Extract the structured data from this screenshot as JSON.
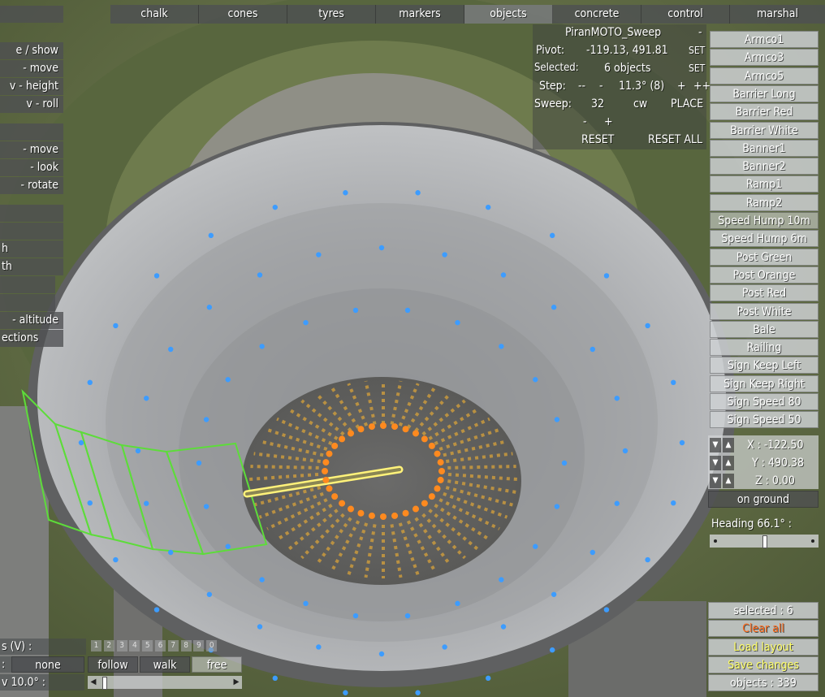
{
  "tabs": [
    "chalk",
    "cones",
    "tyres",
    "markers",
    "objects",
    "concrete",
    "control",
    "marshal"
  ],
  "active_tab": "objects",
  "top_panel": {
    "layout_name": "PiranMOTO_Sweep",
    "collapse": "-",
    "pivot_label": "Pivot:",
    "pivot_value": "-119.13, 491.81",
    "pivot_set": "SET",
    "selected_label": "Selected:",
    "selected_value": "6 objects",
    "selected_set": "SET",
    "step_label": "Step:",
    "step_dec2": "--",
    "step_dec1": "-",
    "step_value": "11.3° (8)",
    "step_inc1": "+",
    "step_inc2": "++",
    "sweep_label": "Sweep:",
    "sweep_value": "32",
    "sweep_dir": "cw",
    "place": "PLACE",
    "sweep_minus": "-",
    "sweep_plus": "+",
    "reset": "RESET",
    "reset_all": "RESET ALL"
  },
  "objects": [
    "Armco1",
    "Armco3",
    "Armco5",
    "Barrier Long",
    "Barrier Red",
    "Barrier White",
    "Banner1",
    "Banner2",
    "Ramp1",
    "Ramp2",
    "Speed Hump 10m",
    "Speed Hump 6m",
    "Post Green",
    "Post Orange",
    "Post Red",
    "Post White",
    "Bale",
    "Railing",
    "Sign Keep Left",
    "Sign Keep Right",
    "Sign Speed 80",
    "Sign Speed 50"
  ],
  "selected_object": "Speed Hump 10m",
  "coords": {
    "x": "X : -122.50",
    "y": "Y : 490.38",
    "z": "Z : 0.00",
    "on_ground": "on ground",
    "up": "▲",
    "down": "▼"
  },
  "heading": {
    "label": "Heading 66.1° :",
    "value_fraction": 0.5
  },
  "bottom_right": {
    "selected": "selected : 6",
    "clear_all": "Clear all",
    "load_layout": "Load layout",
    "save_changes": "Save changes",
    "objects_count": "objects : 339"
  },
  "left_panel": {
    "items": [
      "e / show",
      "- move",
      "v - height",
      "v - roll",
      "- move",
      "- look",
      "- rotate",
      "h",
      "th",
      "- altitude",
      "ections"
    ],
    "camera_label": "s (V) :",
    "colon": ":",
    "none": "none",
    "follow": "follow",
    "walk": "walk",
    "free": "free",
    "fov": "v 10.0° :",
    "numbers": [
      "1",
      "2",
      "3",
      "4",
      "5",
      "6",
      "7",
      "8",
      "9",
      "0"
    ]
  },
  "colors": {
    "selection": "#5ddc3a",
    "dot": "#3d9cff",
    "orange": "#ff8a1f",
    "highlight": "#fff27a",
    "clear_all": "#ff6a1a",
    "yellow_text": "#ffff66"
  }
}
